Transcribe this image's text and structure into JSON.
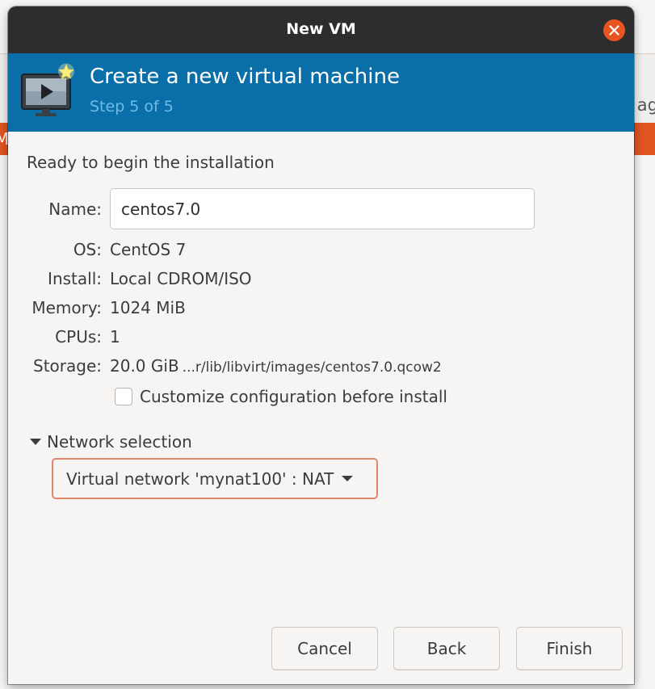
{
  "background": {
    "left_edge_text": "M",
    "right_edge_text": "ag"
  },
  "dialog": {
    "title": "New VM",
    "close_icon": "close-icon"
  },
  "banner": {
    "title": "Create a new virtual machine",
    "step": "Step 5 of 5",
    "icon": "virtual-machine-icon",
    "color": "#0a6ea8"
  },
  "summary": {
    "heading": "Ready to begin the installation",
    "name_label": "Name:",
    "name_value": "centos7.0",
    "os_label": "OS:",
    "os_value": "CentOS 7",
    "install_label": "Install:",
    "install_value": "Local CDROM/ISO",
    "memory_label": "Memory:",
    "memory_value": "1024 MiB",
    "cpus_label": "CPUs:",
    "cpus_value": "1",
    "storage_label": "Storage:",
    "storage_size": "20.0 GiB",
    "storage_path": "...r/lib/libvirt/images/centos7.0.qcow2"
  },
  "customize": {
    "label": "Customize configuration before install",
    "checked": false
  },
  "network": {
    "expander_label": "Network selection",
    "selected": "Virtual network 'mynat100' : NAT"
  },
  "buttons": {
    "cancel": "Cancel",
    "back": "Back",
    "finish": "Finish"
  }
}
